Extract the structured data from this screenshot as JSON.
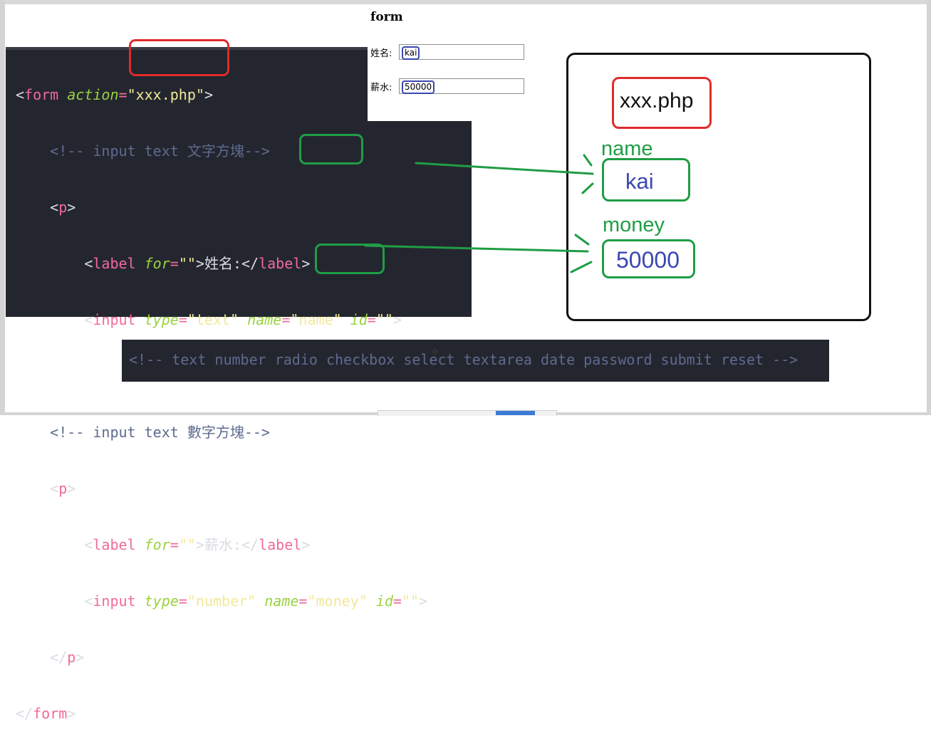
{
  "preview": {
    "title": "form",
    "row1_label": "姓名:",
    "row1_value": "kai",
    "row2_label": "薪水:",
    "row2_value": "50000"
  },
  "code": {
    "l1": {
      "lt": "<",
      "tag": "form",
      "attr": "action",
      "eq": "=",
      "str": "\"xxx.php\"",
      "gt": ">"
    },
    "l2": {
      "cmt": "<!-- input text 文字方塊-->"
    },
    "l3": {
      "lt": "<",
      "tag": "p",
      "gt": ">"
    },
    "l4": {
      "lt": "<",
      "tag": "label",
      "attr": "for",
      "eq": "=",
      "str": "\"\"",
      "gt": ">",
      "text": "姓名:",
      "close_lt": "</",
      "close_tag": "label",
      "close_gt": ">"
    },
    "l5": {
      "lt": "<",
      "tag": "input",
      "attr1": "type",
      "eq1": "=",
      "str1": "\"text\"",
      "attr2": "name",
      "eq2": "=",
      "str2": "\"name\"",
      "attr3": "id",
      "eq3": "=",
      "str3": "\"\"",
      "gt": ">"
    },
    "l7": {
      "cmt": "<!-- input text 數字方塊-->"
    },
    "l8": {
      "lt": "<",
      "tag": "p",
      "gt": ">"
    },
    "l9": {
      "lt": "<",
      "tag": "label",
      "attr": "for",
      "eq": "=",
      "str": "\"\"",
      "gt": ">",
      "text": "薪水:",
      "close_lt": "</",
      "close_tag": "label",
      "close_gt": ">"
    },
    "l10": {
      "lt": "<",
      "tag": "input",
      "attr1": "type",
      "eq1": "=",
      "str1": "\"number\"",
      "attr2": "name",
      "eq2": "=",
      "str2": "\"money\"",
      "attr3": "id",
      "eq3": "=",
      "str3": "\"\"",
      "gt": ">"
    },
    "l11": {
      "lt": "</",
      "tag": "p",
      "gt": ">"
    },
    "l12": {
      "lt": "</",
      "tag": "form",
      "gt": ">"
    }
  },
  "board": {
    "action": "xxx.php",
    "name_label": "name",
    "name_value": "kai",
    "money_label": "money",
    "money_value": "50000"
  },
  "comment_bar": "<!-- text number radio checkbox select textarea date password submit reset -->",
  "colors": {
    "highlight_red": "#e02b2b",
    "highlight_green": "#1f9d45",
    "value_blue": "#3a47b0",
    "editor_bg": "#24262f"
  },
  "icons": [
    "move-cursor-icon"
  ]
}
